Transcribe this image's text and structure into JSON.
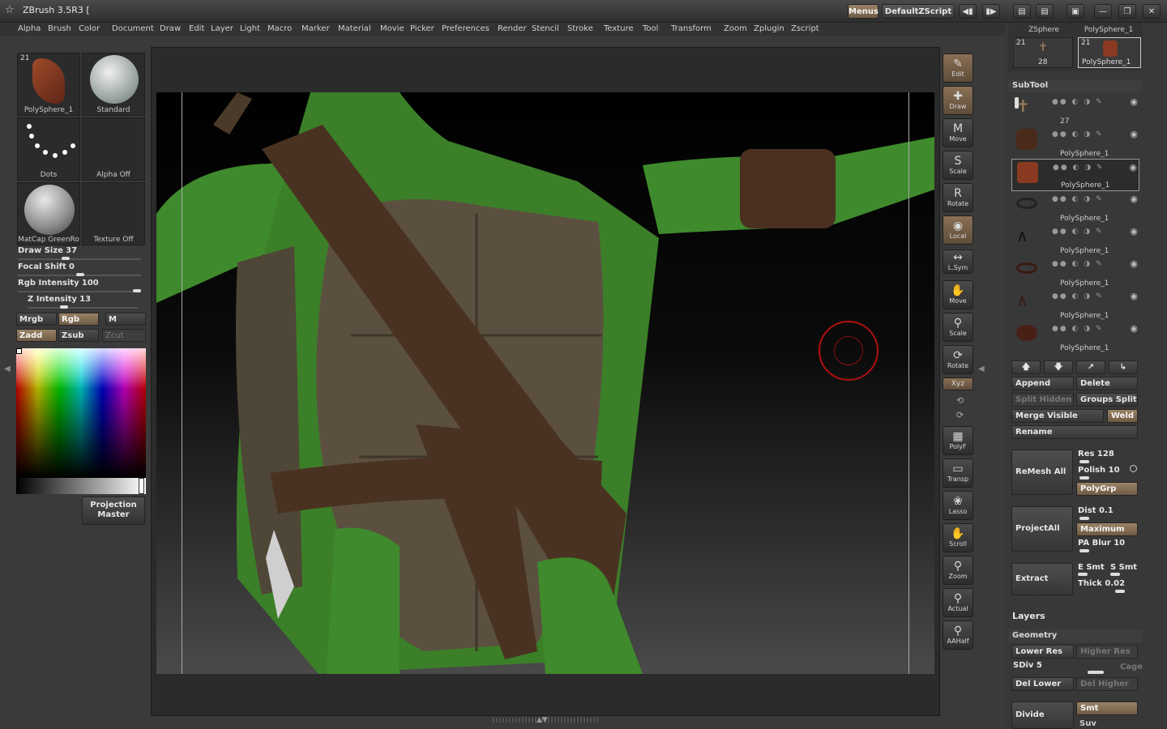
{
  "app": {
    "title": "ZBrush 3.5R3 ["
  },
  "menubar": [
    "Alpha",
    "Brush",
    "Color",
    "Document",
    "Draw",
    "Edit",
    "Layer",
    "Light",
    "Macro",
    "Marker",
    "Material",
    "Movie",
    "Picker",
    "Preferences",
    "Render",
    "Stencil",
    "Stroke",
    "Texture",
    "Tool",
    "Transform",
    "Zoom",
    "Zplugin",
    "Zscript"
  ],
  "topright": {
    "menus": "Menus",
    "script": "DefaultZScript"
  },
  "left": {
    "thumbs": [
      {
        "label": "PolySphere_1",
        "badge": "21"
      },
      {
        "label": "Standard"
      },
      {
        "label": "Dots"
      },
      {
        "label": "Alpha Off"
      },
      {
        "label": "MatCap GreenRo"
      },
      {
        "label": "Texture Off"
      }
    ],
    "sliders": [
      {
        "label": "Draw Size",
        "value": "37",
        "pos": 0.37
      },
      {
        "label": "Focal Shift",
        "value": "0",
        "pos": 0.5
      },
      {
        "label": "Rgb Intensity",
        "value": "100",
        "pos": 1.0
      },
      {
        "label": "Z Intensity",
        "value": "13",
        "pos": 0.13
      }
    ],
    "mrgb": "Mrgb",
    "rgb": "Rgb",
    "m": "M",
    "zadd": "Zadd",
    "zsub": "Zsub",
    "zcut": "Zcut",
    "projection": "Projection Master"
  },
  "tools": [
    "Edit",
    "Draw",
    "Move",
    "Scale",
    "Rotate",
    "Local",
    "L.Sym",
    "Move",
    "Scale",
    "Rotate",
    "Xyz",
    "PolyF",
    "Transp",
    "Lasso",
    "Scroll",
    "Zoom",
    "Actual",
    "AAHalf"
  ],
  "right": {
    "top_tools": [
      {
        "label": "ZSphere",
        "count": "21",
        "sub": "28"
      },
      {
        "label": "PolySphere_1",
        "count": "21",
        "sub": "PolySphere_1"
      }
    ],
    "subtool_head": "SubTool",
    "subtools": [
      "27",
      "PolySphere_1",
      "PolySphere_1",
      "PolySphere_1",
      "PolySphere_1",
      "PolySphere_1",
      "PolySphere_1",
      "PolySphere_1"
    ],
    "append": "Append",
    "delete": "Delete",
    "split_hidden": "Split Hidden",
    "groups_split": "Groups Split",
    "merge_visible": "Merge Visible",
    "weld": "Weld",
    "rename": "Rename",
    "remesh": "ReMesh All",
    "res": "Res 128",
    "polish": "Polish 10",
    "polygrp": "PolyGrp",
    "projectall": "ProjectAll",
    "dist": "Dist 0.1",
    "maximum": "Maximum",
    "pablur": "PA Blur 10",
    "extract": "Extract",
    "esmt": "E Smt",
    "ssmt": "S Smt",
    "thick": "Thick 0.02",
    "layers": "Layers",
    "geometry": "Geometry",
    "lower_res": "Lower Res",
    "higher_res": "Higher Res",
    "sdiv": "SDiv 5",
    "cage": "Cage",
    "del_lower": "Del Lower",
    "del_higher": "Del Higher",
    "divide": "Divide",
    "smt": "Smt",
    "suv": "Suv"
  }
}
